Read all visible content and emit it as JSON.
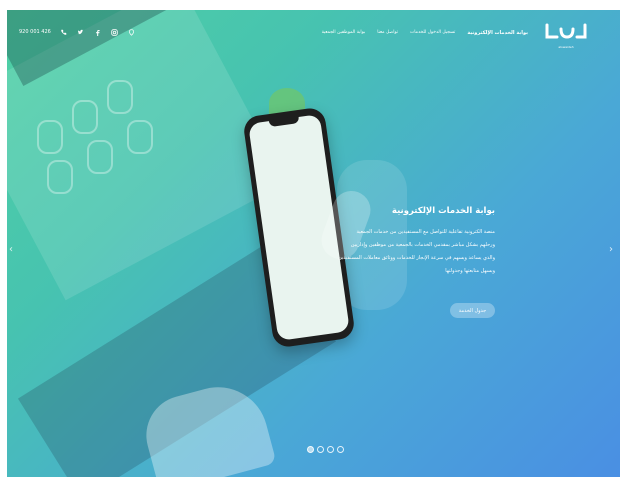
{
  "brand": {
    "logo_text": "العوجه",
    "logo_sub": "alowaideh"
  },
  "nav": {
    "links": [
      "بوابة الخدمات الإلكترونية",
      "تسجيل الدخول للخدمات",
      "تواصل معنا",
      "بوابة الموظفين الجمعية"
    ],
    "phone": "920 001 426",
    "icons": [
      "phone-icon",
      "twitter-icon",
      "facebook-icon",
      "instagram-icon",
      "location-icon"
    ]
  },
  "hero": {
    "title": "بوابة الخدمات الإلكترونية",
    "lines": [
      "منصة الكترونية تفاعلية للتواصل مع المستفيدين من خدمات الجمعية",
      "ورحلهم بشكل مباشر بمقدمي الخدمات بالجمعية من موظفين وإداريين",
      "والذي يساعد ويسهم في سرعة الإنجاز للخدمات ووثائق معاملات المستفيدين",
      "ويسهل متابعتها وجدولتها"
    ],
    "cta": "جدول الخدمة"
  },
  "slider": {
    "prev": "‹",
    "next": "›",
    "dot_count": 4,
    "active_index": 0
  },
  "colors": {
    "gradient_start": "#4fd0a4",
    "gradient_end": "#4a8fe3"
  }
}
